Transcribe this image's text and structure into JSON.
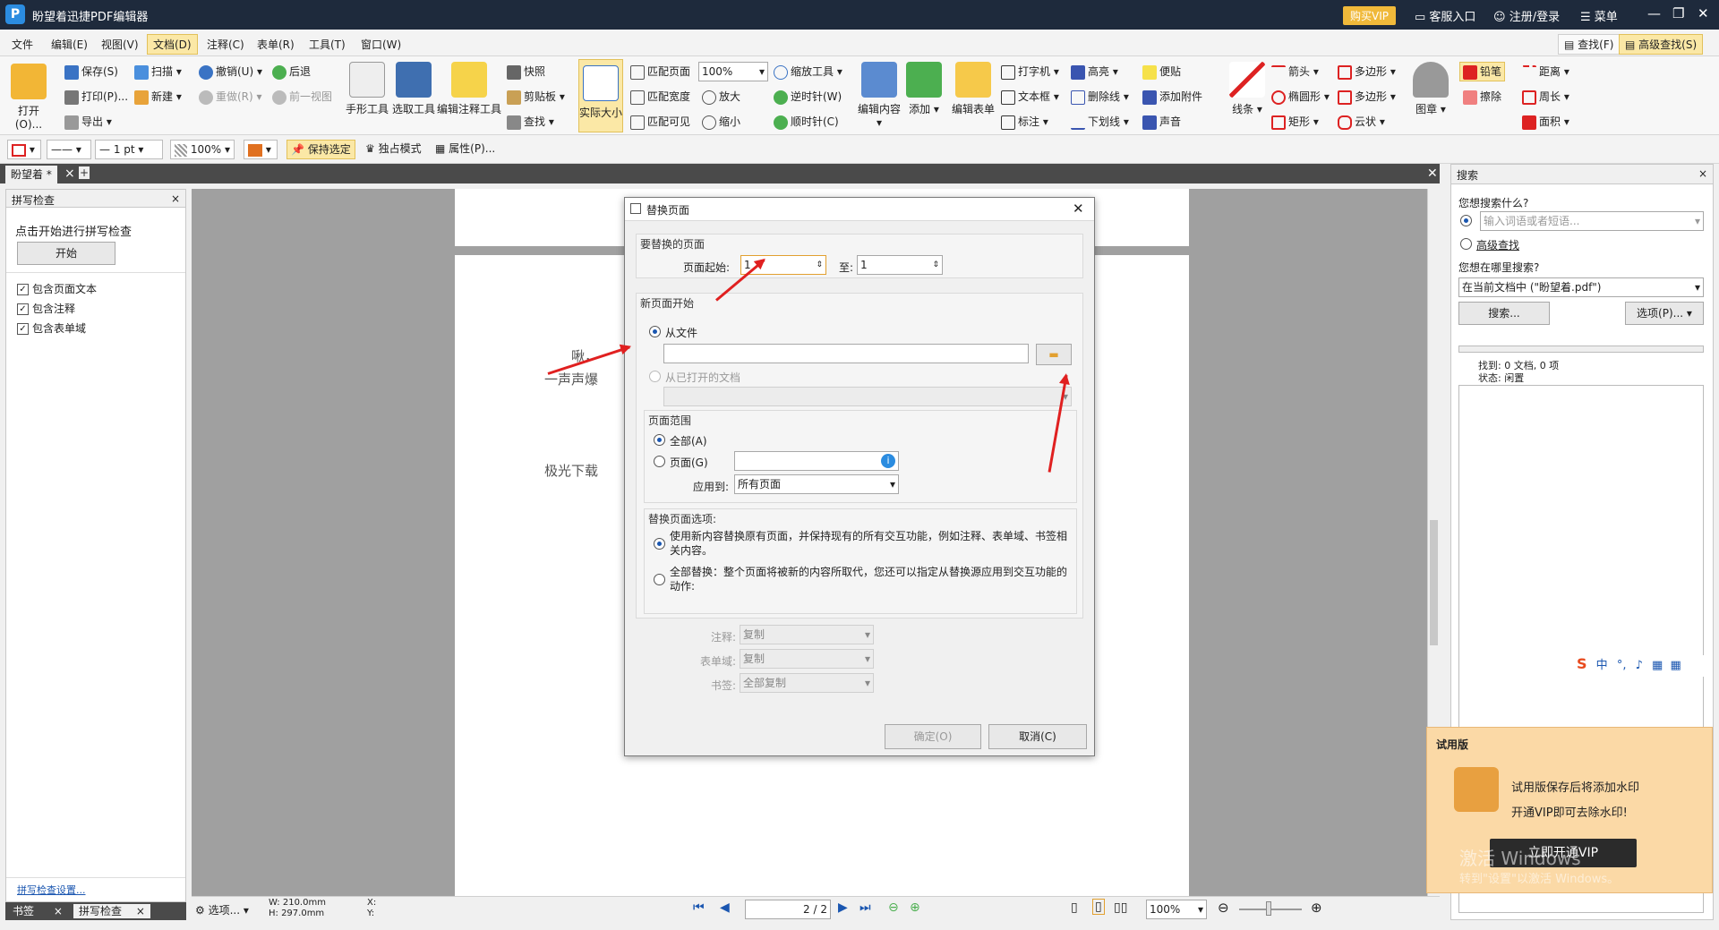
{
  "app": {
    "title": "盼望着迅捷PDF编辑器",
    "logo": "P",
    "vip_button": "购买VIP",
    "customer_service": "客服入口",
    "login": "注册/登录",
    "menu": "菜单"
  },
  "menubar": {
    "items": [
      "文件",
      "编辑(E)",
      "视图(V)",
      "文档(D)",
      "注释(C)",
      "表单(R)",
      "工具(T)",
      "窗口(W)"
    ],
    "active_index": 3,
    "find": "查找(F)",
    "advanced_find": "高级查找(S)"
  },
  "ribbon": {
    "open": "打开(O)...",
    "save": "保存(S)",
    "print": "打印(P)...",
    "export": "导出",
    "scan": "扫描",
    "new": "新建",
    "undo": "撤销(U)",
    "redo": "重做(R)",
    "back": "后退",
    "prev_view": "前一视图",
    "hand_tool": "手形工具",
    "select_tool": "选取工具",
    "edit_annot_tool": "编辑注释工具",
    "snapshot": "快照",
    "clipboard": "剪贴板",
    "find": "查找",
    "actual_size": "实际大小",
    "fit_page": "匹配页面",
    "fit_width": "匹配宽度",
    "fit_visible": "匹配可见",
    "zoom_value": "100%",
    "zoom_tool": "缩放工具",
    "zoom_in": "放大",
    "zoom_out": "缩小",
    "rotate_ccw": "逆时针(W)",
    "rotate_cw": "顺时针(C)",
    "edit_content": "编辑内容",
    "add": "添加",
    "edit_form": "编辑表单",
    "typewriter": "打字机",
    "textbox": "文本框",
    "callout": "标注",
    "highlight": "高亮",
    "strikethrough": "删除线",
    "underline": "下划线",
    "note": "便贴",
    "attach": "添加附件",
    "sound": "声音",
    "line": "线条",
    "arrow": "箭头",
    "ellipse": "椭圆形",
    "rect": "矩形",
    "polygon": "多边形",
    "polyline": "多边形",
    "cloud": "云状",
    "stamp": "图章",
    "pencil": "铅笔",
    "eraser": "擦除",
    "distance": "距离",
    "perimeter": "周长",
    "area": "面积"
  },
  "formatbar": {
    "line_width": "1 pt",
    "opacity": "100%",
    "keep_selected": "保持选定",
    "exclusive_mode": "独占模式",
    "properties": "属性(P)..."
  },
  "tabs": {
    "doc_tab": "盼望着 *"
  },
  "spellcheck": {
    "title": "拼写检查",
    "prompt": "点击开始进行拼写检查",
    "start": "开始",
    "options": [
      "包含页面文本",
      "包含注释",
      "包含表单域"
    ],
    "settings_link": "拼写检查设置..."
  },
  "page_text": {
    "line1": "啾，",
    "line2": "一声声爆",
    "line3": "极光下载"
  },
  "dialog": {
    "title": "替换页面",
    "group1": "要替换的页面",
    "start_label": "页面起始:",
    "start_value": "1",
    "to_label": "至:",
    "to_value": "1",
    "group2": "新页面开始",
    "from_file": "从文件",
    "from_opened": "从已打开的文档",
    "group3": "页面范围",
    "all": "全部(A)",
    "pages": "页面(G)",
    "apply_to": "应用到:",
    "apply_value": "所有页面",
    "group4": "替换页面选项:",
    "opt1": "使用新内容替换原有页面，并保持现有的所有交互功能，例如注释、表单域、书签相关内容。",
    "opt2": "全部替换：整个页面将被新的内容所取代，您还可以指定从替换源应用到交互功能的动作:",
    "annot_label": "注释:",
    "annot_value": "复制",
    "form_label": "表单域:",
    "form_value": "复制",
    "bookmark_label": "书签:",
    "bookmark_value": "全部复制",
    "ok": "确定(O)",
    "cancel": "取消(C)"
  },
  "search": {
    "title": "搜索",
    "question": "您想搜索什么?",
    "placeholder": "输入词语或者短语...",
    "advanced": "高级查找",
    "where": "您想在哪里搜索?",
    "scope": "在当前文档中 (\"盼望着.pdf\")",
    "search_btn": "搜索...",
    "options_btn": "选项(P)...",
    "found": "找到: 0 文档, 0 项",
    "status": "状态: 闲置"
  },
  "statusbar": {
    "options": "选项...",
    "width": "W: 210.0mm",
    "height": "H: 297.0mm",
    "x": "X:",
    "y": "Y:",
    "page": "2",
    "page_total": "/ 2",
    "zoom": "100%"
  },
  "bottom_tabs": {
    "bookmarks": "书签",
    "spellcheck": "拼写检查"
  },
  "trial": {
    "title": "试用版",
    "line1": "试用版保存后将添加水印",
    "line2": "开通VIP即可去除水印!",
    "button": "立即开通VIP",
    "watermark1": "激活 Windows",
    "watermark2": "转到\"设置\"以激活 Windows。"
  },
  "ime": {
    "label": "中"
  },
  "colors": {
    "titlebar": "#1e2a3c",
    "accent_gold": "#fbe8a6",
    "arrow_red": "#e02020"
  }
}
